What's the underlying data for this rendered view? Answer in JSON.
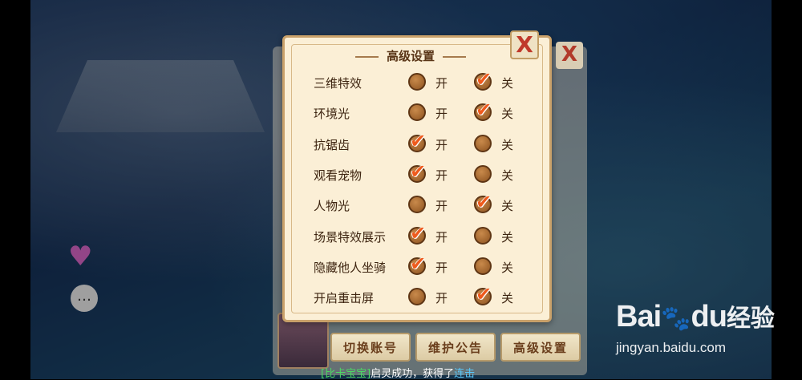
{
  "background": {
    "chat_badge_icon": "chat-bubble-icon",
    "bottom_buttons": [
      "切换账号",
      "维护公告",
      "高级设置"
    ],
    "back_close_label": "X",
    "chat_log": [
      "[比卡宝宝]启灵成功，获得了连击"
    ]
  },
  "dialog": {
    "title": "高级设置",
    "close_label": "X",
    "on_label": "开",
    "off_label": "关",
    "settings": [
      {
        "label": "三维特效",
        "value": "off"
      },
      {
        "label": "环境光",
        "value": "off"
      },
      {
        "label": "抗锯齿",
        "value": "on"
      },
      {
        "label": "观看宠物",
        "value": "on"
      },
      {
        "label": "人物光",
        "value": "off"
      },
      {
        "label": "场景特效展示",
        "value": "on"
      },
      {
        "label": "隐藏他人坐骑",
        "value": "on"
      },
      {
        "label": "开启重击屏",
        "value": "off"
      }
    ]
  },
  "banner": {
    "prefix": "[比卡宝宝]",
    "middle": "启灵成功，获得了",
    "suffix": "连击"
  },
  "watermark": {
    "logo_left": "Bai",
    "logo_right": "du",
    "logo_cn": "经验",
    "url": "jingyan.baidu.com"
  },
  "colors": {
    "accent_check": "#ef5a1c",
    "dialog_bg": "#fbefd6",
    "banner_green": "#4cd964",
    "banner_blue": "#5ac8fa"
  }
}
